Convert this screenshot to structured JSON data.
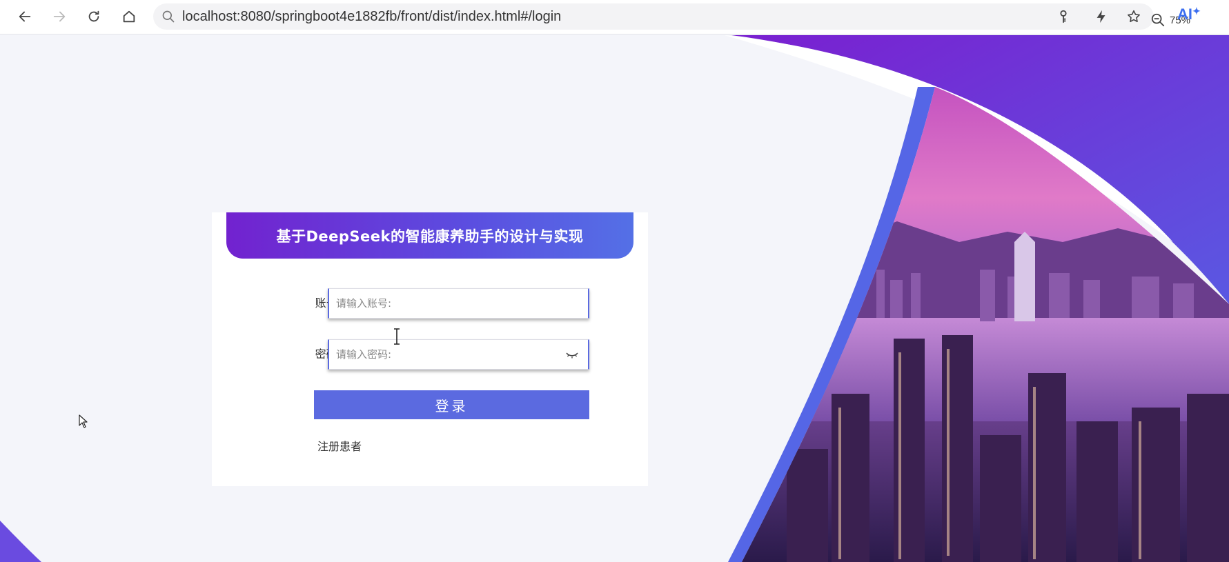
{
  "browser": {
    "url": "localhost:8080/springboot4e1882fb/front/dist/index.html#/login",
    "zoom": "75%",
    "ai_label": "AI"
  },
  "login": {
    "title": "基于DeepSeek的智能康养助手的设计与实现",
    "account_label": "账号:",
    "account_placeholder": "请输入账号:",
    "password_label": "密码:",
    "password_placeholder": "请输入密码:",
    "login_button": "登录",
    "register_link": "注册患者"
  },
  "colors": {
    "accent": "#5b6ae0",
    "header_gradient_start": "#7222cf",
    "header_gradient_end": "#5470e6",
    "page_background": "#f4f5fa"
  },
  "icons": [
    "back-arrow-icon",
    "forward-arrow-icon",
    "reload-icon",
    "home-icon",
    "search-icon",
    "zoom-out-icon",
    "key-icon",
    "lightning-icon",
    "star-icon",
    "eye-closed-icon"
  ]
}
